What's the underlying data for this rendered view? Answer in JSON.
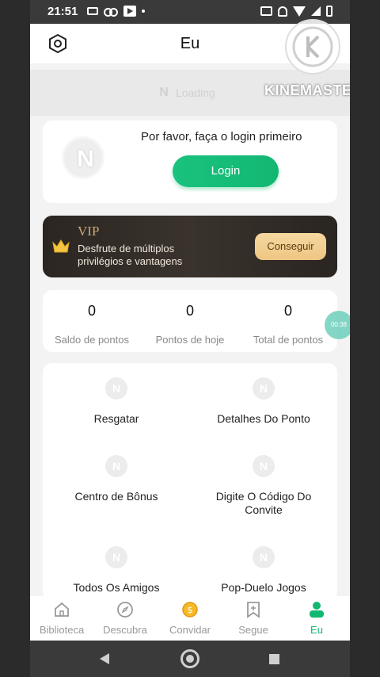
{
  "status_bar": {
    "time": "21:51",
    "left_icons": [
      "video-icon",
      "voicemail-icon",
      "play-store-icon",
      "dot-icon"
    ],
    "right_icons": [
      "cast-off-icon",
      "mute-icon",
      "wifi-icon",
      "signal-icon",
      "battery-icon"
    ]
  },
  "header": {
    "title": "Eu",
    "settings_icon": "hexagon-settings-icon"
  },
  "watermark": {
    "text": "KINEMASTER"
  },
  "loading_banner": {
    "text": "Loading"
  },
  "login_card": {
    "prompt": "Por favor, faça o login primeiro",
    "button_label": "Login",
    "avatar_letter": "N"
  },
  "vip": {
    "title": "VIP",
    "description": "Desfrute de múltiplos privilégios e vantagens",
    "button_label": "Conseguir"
  },
  "stats": [
    {
      "value": "0",
      "label": "Saldo de pontos"
    },
    {
      "value": "0",
      "label": "Pontos de hoje"
    },
    {
      "value": "0",
      "label": "Total de pontos"
    }
  ],
  "timer_bubble": "00:38",
  "menu": [
    {
      "label": "Resgatar"
    },
    {
      "label": "Detalhes Do Ponto"
    },
    {
      "label": "Centro de Bônus"
    },
    {
      "label": "Digite O Código Do Convite"
    },
    {
      "label": "Todos Os Amigos"
    },
    {
      "label": "Pop-Duelo Jogos"
    }
  ],
  "bottom_nav": [
    {
      "label": "Biblioteca",
      "icon": "home-icon",
      "active": false
    },
    {
      "label": "Descubra",
      "icon": "compass-icon",
      "active": false
    },
    {
      "label": "Convidar",
      "icon": "coin-icon",
      "active": false
    },
    {
      "label": "Segue",
      "icon": "bookmark-plus-icon",
      "active": false
    },
    {
      "label": "Eu",
      "icon": "person-icon",
      "active": true
    }
  ],
  "colors": {
    "accent_green": "#12b772",
    "vip_gold": "#c9a977",
    "vip_dark": "#2b2622"
  }
}
